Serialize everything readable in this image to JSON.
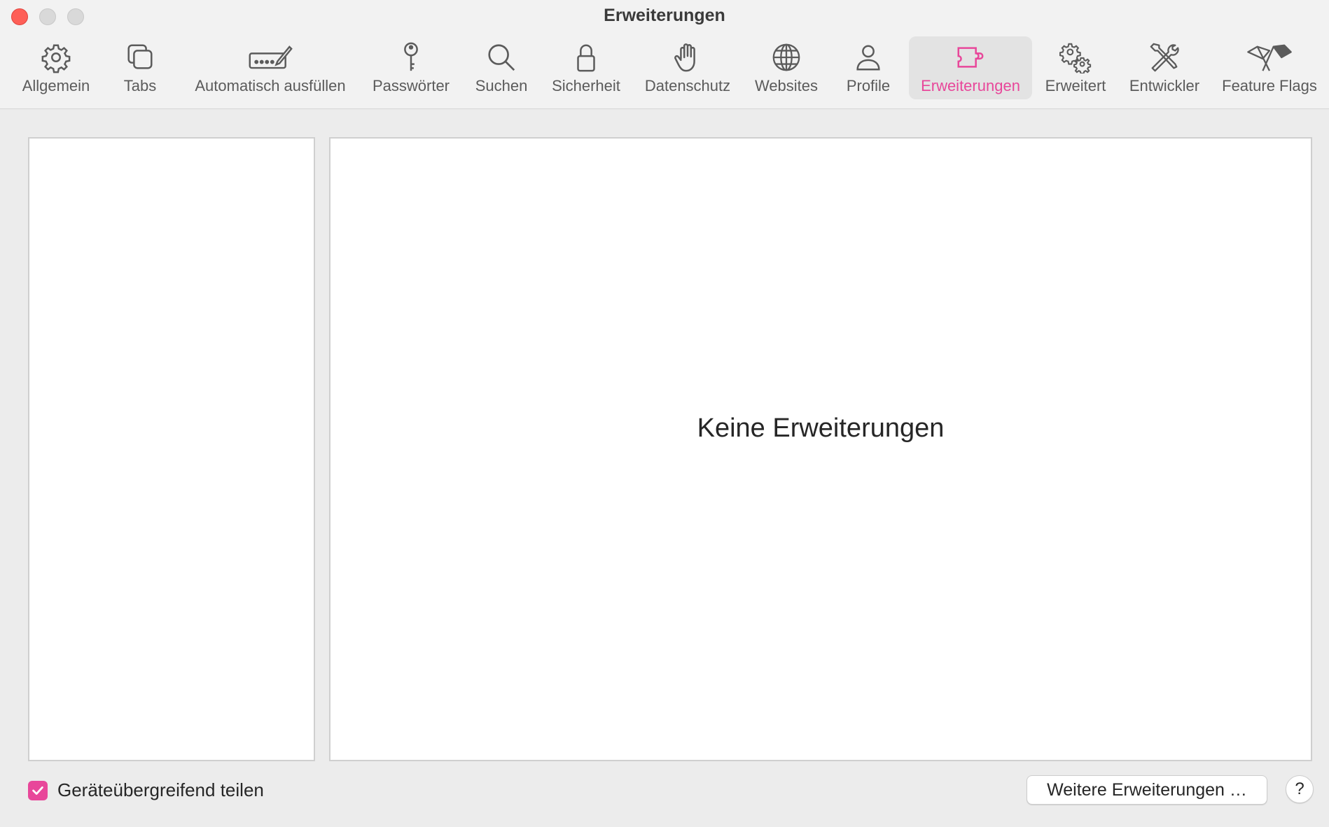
{
  "window": {
    "title": "Erweiterungen"
  },
  "toolbar": {
    "items": [
      {
        "label": "Allgemein",
        "icon": "gear-icon"
      },
      {
        "label": "Tabs",
        "icon": "tabs-icon"
      },
      {
        "label": "Automatisch ausfüllen",
        "icon": "autofill-icon"
      },
      {
        "label": "Passwörter",
        "icon": "key-icon"
      },
      {
        "label": "Suchen",
        "icon": "search-icon"
      },
      {
        "label": "Sicherheit",
        "icon": "lock-icon"
      },
      {
        "label": "Datenschutz",
        "icon": "hand-icon"
      },
      {
        "label": "Websites",
        "icon": "globe-icon"
      },
      {
        "label": "Profile",
        "icon": "person-icon"
      },
      {
        "label": "Erweiterungen",
        "icon": "puzzle-icon",
        "active": true
      },
      {
        "label": "Erweitert",
        "icon": "gears-icon"
      },
      {
        "label": "Entwickler",
        "icon": "tools-icon"
      },
      {
        "label": "Feature Flags",
        "icon": "flags-icon"
      }
    ]
  },
  "detail": {
    "empty_label": "Keine Erweiterungen"
  },
  "footer": {
    "share_label": "Geräteübergreifend teilen",
    "share_checked": true,
    "more_button_label": "Weitere Erweiterungen …",
    "help_label": "?"
  },
  "colors": {
    "accent": "#e8479a",
    "close": "#fe5f57"
  }
}
